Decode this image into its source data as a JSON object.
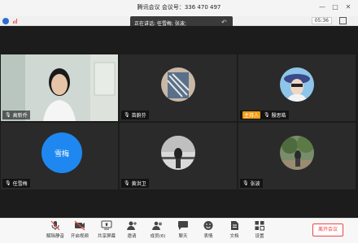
{
  "window": {
    "title": "腾讯会议 会议号：336 470 497"
  },
  "infobar": {
    "timer": "05:36"
  },
  "speaking": {
    "text": "正在讲话: 任雪梅; 张波;"
  },
  "participants": [
    {
      "name": "高新乔",
      "type": "video"
    },
    {
      "name": "苗蔚芬",
      "type": "avatar"
    },
    {
      "name": "殷思皓",
      "type": "avatar",
      "host_tag": "主持人"
    },
    {
      "name": "任雪梅",
      "type": "text-avatar",
      "avatar_text": "雪梅"
    },
    {
      "name": "黄洪卫",
      "type": "avatar"
    },
    {
      "name": "张波",
      "type": "avatar"
    }
  ],
  "toolbar": {
    "items": [
      {
        "label": "解除静音",
        "icon": "mic-muted-icon"
      },
      {
        "label": "开启视频",
        "icon": "video-off-icon"
      },
      {
        "label": "共享屏幕",
        "icon": "share-screen-icon"
      },
      {
        "label": "邀请",
        "icon": "invite-icon"
      },
      {
        "label": "成员(6)",
        "icon": "members-icon"
      },
      {
        "label": "聊天",
        "icon": "chat-icon"
      },
      {
        "label": "表情",
        "icon": "emoji-icon"
      },
      {
        "label": "文档",
        "icon": "document-icon"
      },
      {
        "label": "设置",
        "icon": "settings-icon"
      }
    ],
    "leave_label": "离开会议"
  },
  "colors": {
    "accent": "#1e88f0",
    "leave": "#e44444",
    "host": "#f39c12"
  }
}
